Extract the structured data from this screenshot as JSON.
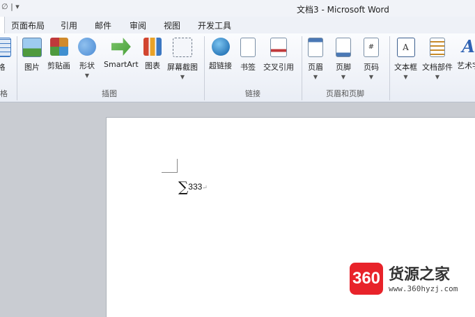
{
  "window": {
    "title": "文档3 - Microsoft Word",
    "qat_glyphs": "∅ | ▾"
  },
  "tabs": [
    "页面布局",
    "引用",
    "邮件",
    "审阅",
    "视图",
    "开发工具"
  ],
  "ribbon": {
    "buttons": [
      {
        "label": "格",
        "icon": "table-icon",
        "color": "#3b77c2"
      },
      {
        "label": "图片",
        "icon": "picture-icon",
        "color": "#4f9a3e"
      },
      {
        "label": "剪贴画",
        "icon": "clipart-icon",
        "color": "#d08a2c"
      },
      {
        "label": "形状",
        "icon": "shapes-icon",
        "color": "#4a8ad4"
      },
      {
        "label": "SmartArt",
        "icon": "smartart-icon",
        "color": "#49a03a"
      },
      {
        "label": "图表",
        "icon": "chart-icon",
        "color": "#d2452f"
      },
      {
        "label": "屏幕截图",
        "icon": "screenshot-icon",
        "color": "#6b7787"
      },
      {
        "label": "超链接",
        "icon": "hyperlink-icon",
        "color": "#2f7dbd"
      },
      {
        "label": "书签",
        "icon": "bookmark-icon",
        "color": "#7a8fa6"
      },
      {
        "label": "交叉引用",
        "icon": "cross-reference-icon",
        "color": "#c0393b"
      },
      {
        "label": "页眉",
        "icon": "header-icon",
        "color": "#4a78b5"
      },
      {
        "label": "页脚",
        "icon": "footer-icon",
        "color": "#4a78b5"
      },
      {
        "label": "页码",
        "icon": "page-number-icon",
        "color": "#4a78b5"
      },
      {
        "label": "文本框",
        "icon": "textbox-icon",
        "color": "#3c5f8f"
      },
      {
        "label": "文档部件",
        "icon": "quick-parts-icon",
        "color": "#c78a2a"
      },
      {
        "label": "艺术字",
        "icon": "wordart-icon",
        "color": "#2f62b3"
      }
    ],
    "groups": [
      "格",
      "插图",
      "链接",
      "页眉和页脚"
    ]
  },
  "document": {
    "symbol": "∑",
    "value": "333",
    "paragraph_mark": "↵"
  },
  "watermark": {
    "logo_text": "360",
    "name": "货源之家",
    "url": "www.360hyzj.com"
  }
}
